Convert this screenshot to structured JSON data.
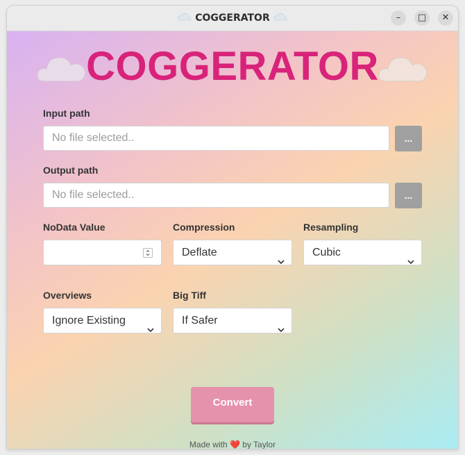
{
  "window": {
    "title": "COGGERATOR",
    "minimize_glyph": "–",
    "maximize_glyph": "□",
    "close_glyph": "✕"
  },
  "app": {
    "title": "COGGERATOR"
  },
  "input_path": {
    "label": "Input path",
    "placeholder": "No file selected..",
    "browse_label": "..."
  },
  "output_path": {
    "label": "Output path",
    "placeholder": "No file selected..",
    "browse_label": "..."
  },
  "nodata": {
    "label": "NoData Value",
    "value": ""
  },
  "compression": {
    "label": "Compression",
    "value": "Deflate"
  },
  "resampling": {
    "label": "Resampling",
    "value": "Cubic"
  },
  "overviews": {
    "label": "Overviews",
    "value": "Ignore Existing"
  },
  "bigtiff": {
    "label": "Big Tiff",
    "value": "If Safer"
  },
  "convert_label": "Convert",
  "footer": {
    "prefix": "Made with",
    "heart": "❤️",
    "suffix": "by Taylor"
  },
  "colors": {
    "title_accent": "#d8237a",
    "convert_button": "#e592ad",
    "browse_button": "#a0a0a0"
  },
  "icons": [
    "cloud-icon",
    "chevron-down-icon",
    "spinner-arrows-icon"
  ]
}
